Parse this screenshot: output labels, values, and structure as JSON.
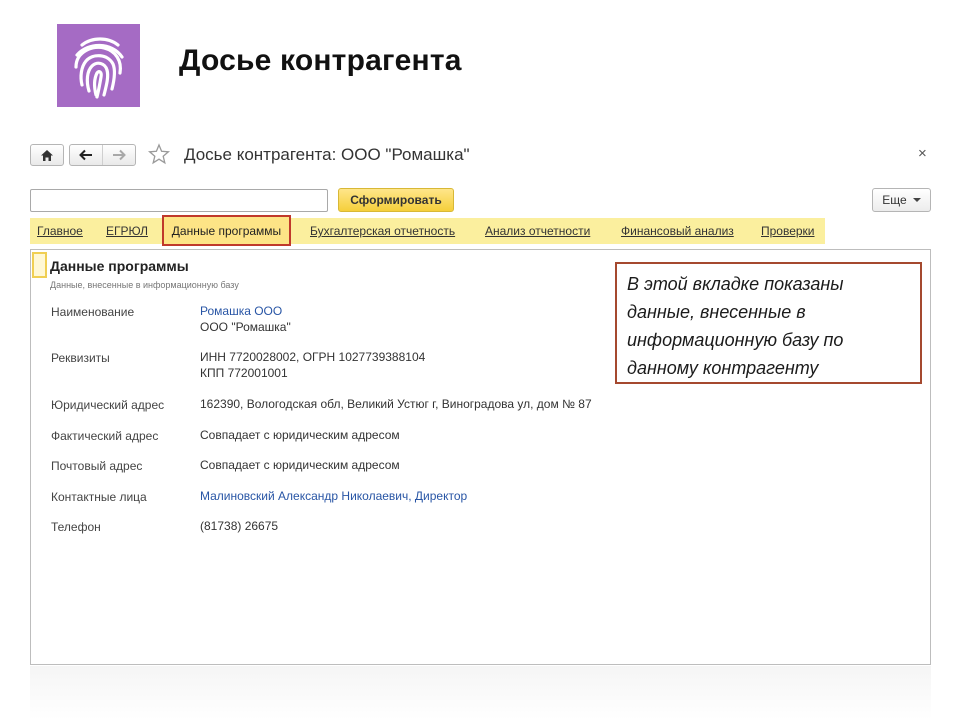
{
  "slide": {
    "title": "Досье контрагента",
    "logo_icon": "fingerprint-icon",
    "logo_color": "#a56bc4"
  },
  "window": {
    "title": "Досье контрагента: ООО \"Ромашка\"",
    "home_icon": "home-icon",
    "back_icon": "arrow-left-icon",
    "forward_icon": "arrow-right-icon",
    "favorite_icon": "star-icon",
    "close_label": "×"
  },
  "search": {
    "value": "",
    "placeholder": ""
  },
  "toolbar": {
    "form_label": "Сформировать",
    "more_label": "Еще"
  },
  "tabs": [
    {
      "label": "Главное"
    },
    {
      "label": "ЕГРЮЛ"
    },
    {
      "label": "Данные программы"
    },
    {
      "label": "Бухгалтерская отчетность"
    },
    {
      "label": "Анализ отчетности"
    },
    {
      "label": "Финансовый анализ"
    },
    {
      "label": "Проверки"
    }
  ],
  "active_tab": "Данные программы",
  "section": {
    "title": "Данные программы",
    "subtitle": "Данные, внесенные в информационную базу"
  },
  "fields": [
    {
      "label": "Наименование",
      "lines": [
        "Ромашка ООО",
        "ООО \"Ромашка\""
      ]
    },
    {
      "label": "Реквизиты",
      "lines": [
        "ИНН 7720028002, ОГРН 1027739388104",
        "КПП 772001001"
      ]
    },
    {
      "label": "Юридический адрес",
      "lines": [
        "162390, Вологодская обл, Великий Устюг г, Виноградова ул, дом № 87"
      ]
    },
    {
      "label": "Фактический адрес",
      "lines": [
        "Совпадает с юридическим адресом"
      ]
    },
    {
      "label": "Почтовый адрес",
      "lines": [
        "Совпадает с юридическим адресом"
      ]
    },
    {
      "label": "Контактные лица",
      "lines": [
        "Малиновский Александр Николаевич, Директор"
      ]
    },
    {
      "label": "Телефон",
      "lines": [
        "(81738) 26675"
      ]
    }
  ],
  "callout": {
    "text": "В этой вкладке показаны данные, внесенные в информационную базу по данному контрагенту"
  },
  "colors": {
    "tab_bar": "#fbef9e",
    "highlight_border": "#c0392b",
    "callout_border": "#a5492f",
    "link": "#2855a5",
    "primary_button": "#f5cf3b"
  }
}
